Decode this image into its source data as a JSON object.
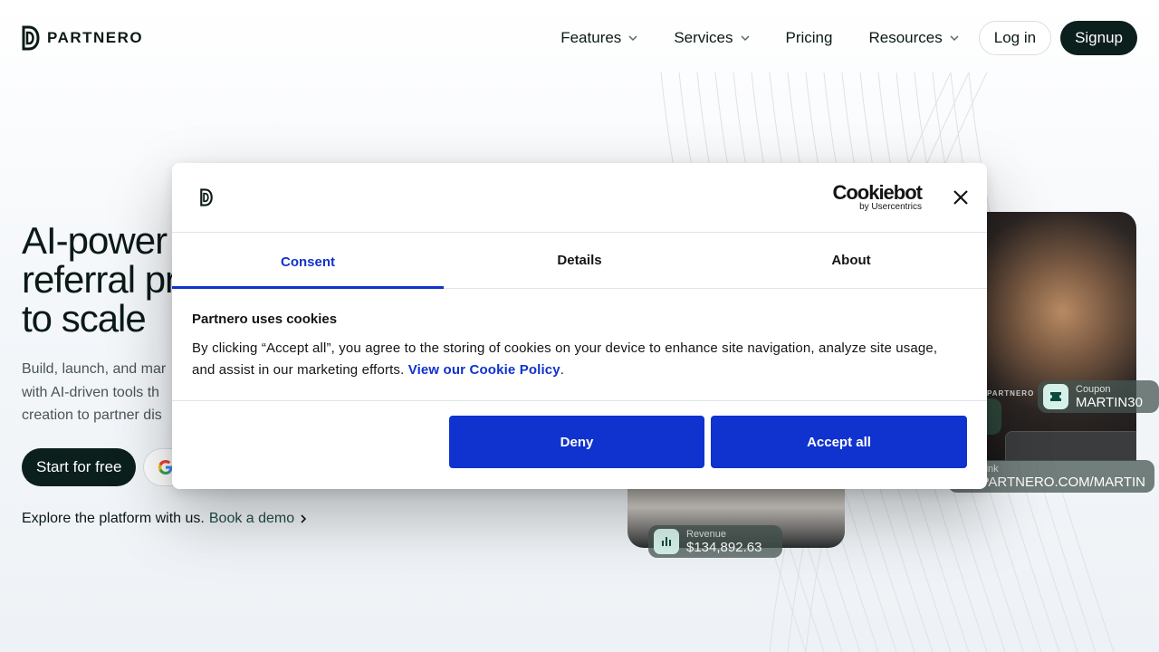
{
  "nav": {
    "logo_text": "PARTNERO",
    "items": [
      {
        "label": "Features",
        "has_dropdown": true
      },
      {
        "label": "Services",
        "has_dropdown": true
      },
      {
        "label": "Pricing",
        "has_dropdown": false
      },
      {
        "label": "Resources",
        "has_dropdown": true
      }
    ],
    "login_label": "Log in",
    "signup_label": "Signup"
  },
  "hero": {
    "title_line1": "AI-power",
    "title_line2": "referral pr",
    "title_line3": "to scale",
    "sub_line1": "Build, launch, and mar",
    "sub_line2": "with AI-driven tools th",
    "sub_line3": "creation to partner dis",
    "start_label": "Start for free",
    "explore_text": "Explore the platform with us.",
    "demo_link": "Book a demo"
  },
  "cards": {
    "coupon_label": "Coupon",
    "coupon_value": "MARTIN30",
    "link_label": "Link",
    "link_value": "PARTNERO.COM/MARTIN",
    "revenue_label": "Revenue",
    "revenue_value": "$134,892.63",
    "shirt_text": "PARTNERO"
  },
  "cookie_dialog": {
    "brand_name": "Cookiebot",
    "brand_by": "by Usercentrics",
    "tabs": [
      {
        "label": "Consent",
        "active": true
      },
      {
        "label": "Details",
        "active": false
      },
      {
        "label": "About",
        "active": false
      }
    ],
    "title": "Partnero uses cookies",
    "body": "By clicking “Accept all”, you agree to the storing of cookies on your device to enhance site navigation, analyze site usage, and assist in our marketing efforts.",
    "policy_link": "View our Cookie Policy",
    "policy_suffix": ".",
    "deny_label": "Deny",
    "accept_label": "Accept all"
  },
  "colors": {
    "accent_blue": "#1032cf",
    "brand_dark": "#0b1f1c",
    "demo_link": "#1e4d47"
  }
}
